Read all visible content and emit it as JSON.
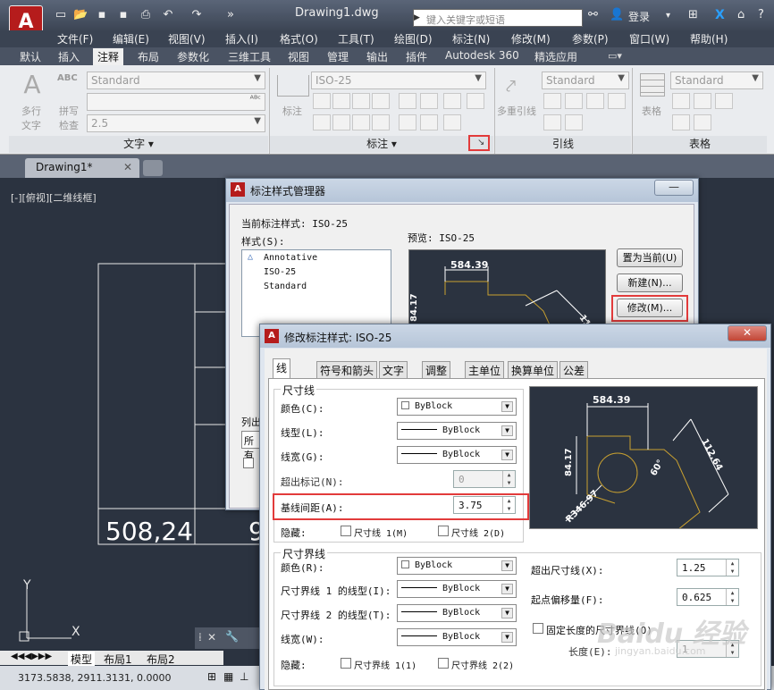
{
  "app": {
    "logo_letter": "A",
    "doc_title": "Drawing1.dwg",
    "search_placeholder": "键入关键字或短语",
    "login": "登录"
  },
  "menu": [
    "文件(F)",
    "编辑(E)",
    "视图(V)",
    "插入(I)",
    "格式(O)",
    "工具(T)",
    "绘图(D)",
    "标注(N)",
    "修改(M)",
    "参数(P)",
    "窗口(W)",
    "帮助(H)"
  ],
  "ribbon_tabs": [
    "默认",
    "插入",
    "注释",
    "布局",
    "参数化",
    "三维工具",
    "视图",
    "管理",
    "输出",
    "插件",
    "Autodesk 360",
    "精选应用"
  ],
  "active_ribbon_tab": "注释",
  "ribbon": {
    "text_panel": {
      "big": "多行文字",
      "big1": "多行",
      "big2": "文字",
      "spell1": "拼写",
      "spell2": "检查",
      "style": "Standard",
      "height": "2.5",
      "footer": "文字 ▾"
    },
    "dim_panel": {
      "big": "标注",
      "style": "ISO-25",
      "footer": "标注 ▾"
    },
    "leader_panel": {
      "big": "多重引线",
      "style": "Standard",
      "footer": "引线"
    },
    "table_panel": {
      "big": "表格",
      "style": "Standard",
      "footer": "表格"
    }
  },
  "doc_tab": "Drawing1*",
  "view_label": "[-][俯视][二维线框]",
  "drawing": {
    "dim1": "508,24",
    "dim2": "9"
  },
  "layout_tabs": [
    "模型",
    "布局1",
    "布局2"
  ],
  "status": {
    "coords": "3173.5838, 2911.3131, 0.0000"
  },
  "dialog1": {
    "title": "标注样式管理器",
    "current_label": "当前标注样式: ISO-25",
    "styles_label": "样式(S):",
    "styles": [
      "Annotative",
      "ISO-25",
      "Standard"
    ],
    "preview_label": "预览: ISO-25",
    "buttons": {
      "set_current": "置为当前(U)",
      "new": "新建(N)...",
      "modify": "修改(M)..."
    },
    "list_label": "列出",
    "list_value": "所有",
    "preview_dims": {
      "d1": "584.39",
      "d2": "84.17",
      "d3": "112"
    }
  },
  "dialog2": {
    "title": "修改标注样式: ISO-25",
    "tabs": [
      "线",
      "符号和箭头",
      "文字",
      "调整",
      "主单位",
      "换算单位",
      "公差"
    ],
    "dimline": {
      "group": "尺寸线",
      "color_label": "颜色(C):",
      "color": "ByBlock",
      "linetype_label": "线型(L):",
      "linetype": "ByBlock",
      "lineweight_label": "线宽(G):",
      "lineweight": "ByBlock",
      "extend_label": "超出标记(N):",
      "extend": "0",
      "baseline_label": "基线间距(A):",
      "baseline": "3.75",
      "suppress_label": "隐藏:",
      "sup1": "尺寸线 1(M)",
      "sup2": "尺寸线 2(D)"
    },
    "extline": {
      "group": "尺寸界线",
      "color_label": "颜色(R):",
      "color": "ByBlock",
      "lt1_label": "尺寸界线 1 的线型(I):",
      "lt1": "ByBlock",
      "lt2_label": "尺寸界线 2 的线型(T):",
      "lt2": "ByBlock",
      "lw_label": "线宽(W):",
      "lw": "ByBlock",
      "suppress_label": "隐藏:",
      "sup1": "尺寸界线 1(1)",
      "sup2": "尺寸界线 2(2)",
      "beyond_label": "超出尺寸线(X):",
      "beyond": "1.25",
      "offset_label": "起点偏移量(F):",
      "offset": "0.625",
      "fixed_label": "固定长度的尺寸界线(O)",
      "length_label": "长度(E):",
      "length": "1"
    },
    "preview_dims": {
      "d1": "584.39",
      "d2": "84.17",
      "d3": "112.64",
      "d4": "R346.97",
      "d5": "60°"
    }
  },
  "watermark": {
    "brand": "Baidu 经验",
    "url": "jingyan.baidu.com"
  }
}
